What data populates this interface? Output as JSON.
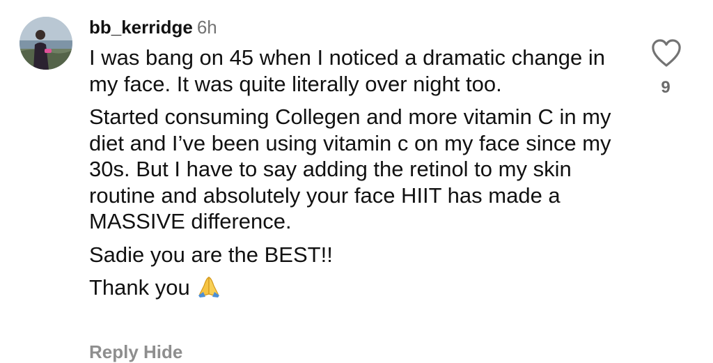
{
  "comment": {
    "username": "bb_kerridge",
    "timestamp": "6h",
    "paragraphs": [
      "I was bang on 45 when I noticed a dramatic change in my face. It was quite literally over night too.",
      "Started consuming Collegen and more vitamin C in my diet and I’ve been using vitamin c on my face since my 30s. But I have to say adding the retinol to my skin routine and absolutely your face HIIT has made a MASSIVE difference.",
      "Sadie you are the BEST!!",
      "Thank you"
    ],
    "emoji_icon": "folded-hands-icon",
    "like_icon": "heart-outline-icon",
    "like_count": "9",
    "reply_hint": "Reply  Hide"
  },
  "colors": {
    "text": "#111111",
    "muted": "#737373",
    "like_count": "#6b6b6b",
    "emoji": "#f6c443"
  }
}
